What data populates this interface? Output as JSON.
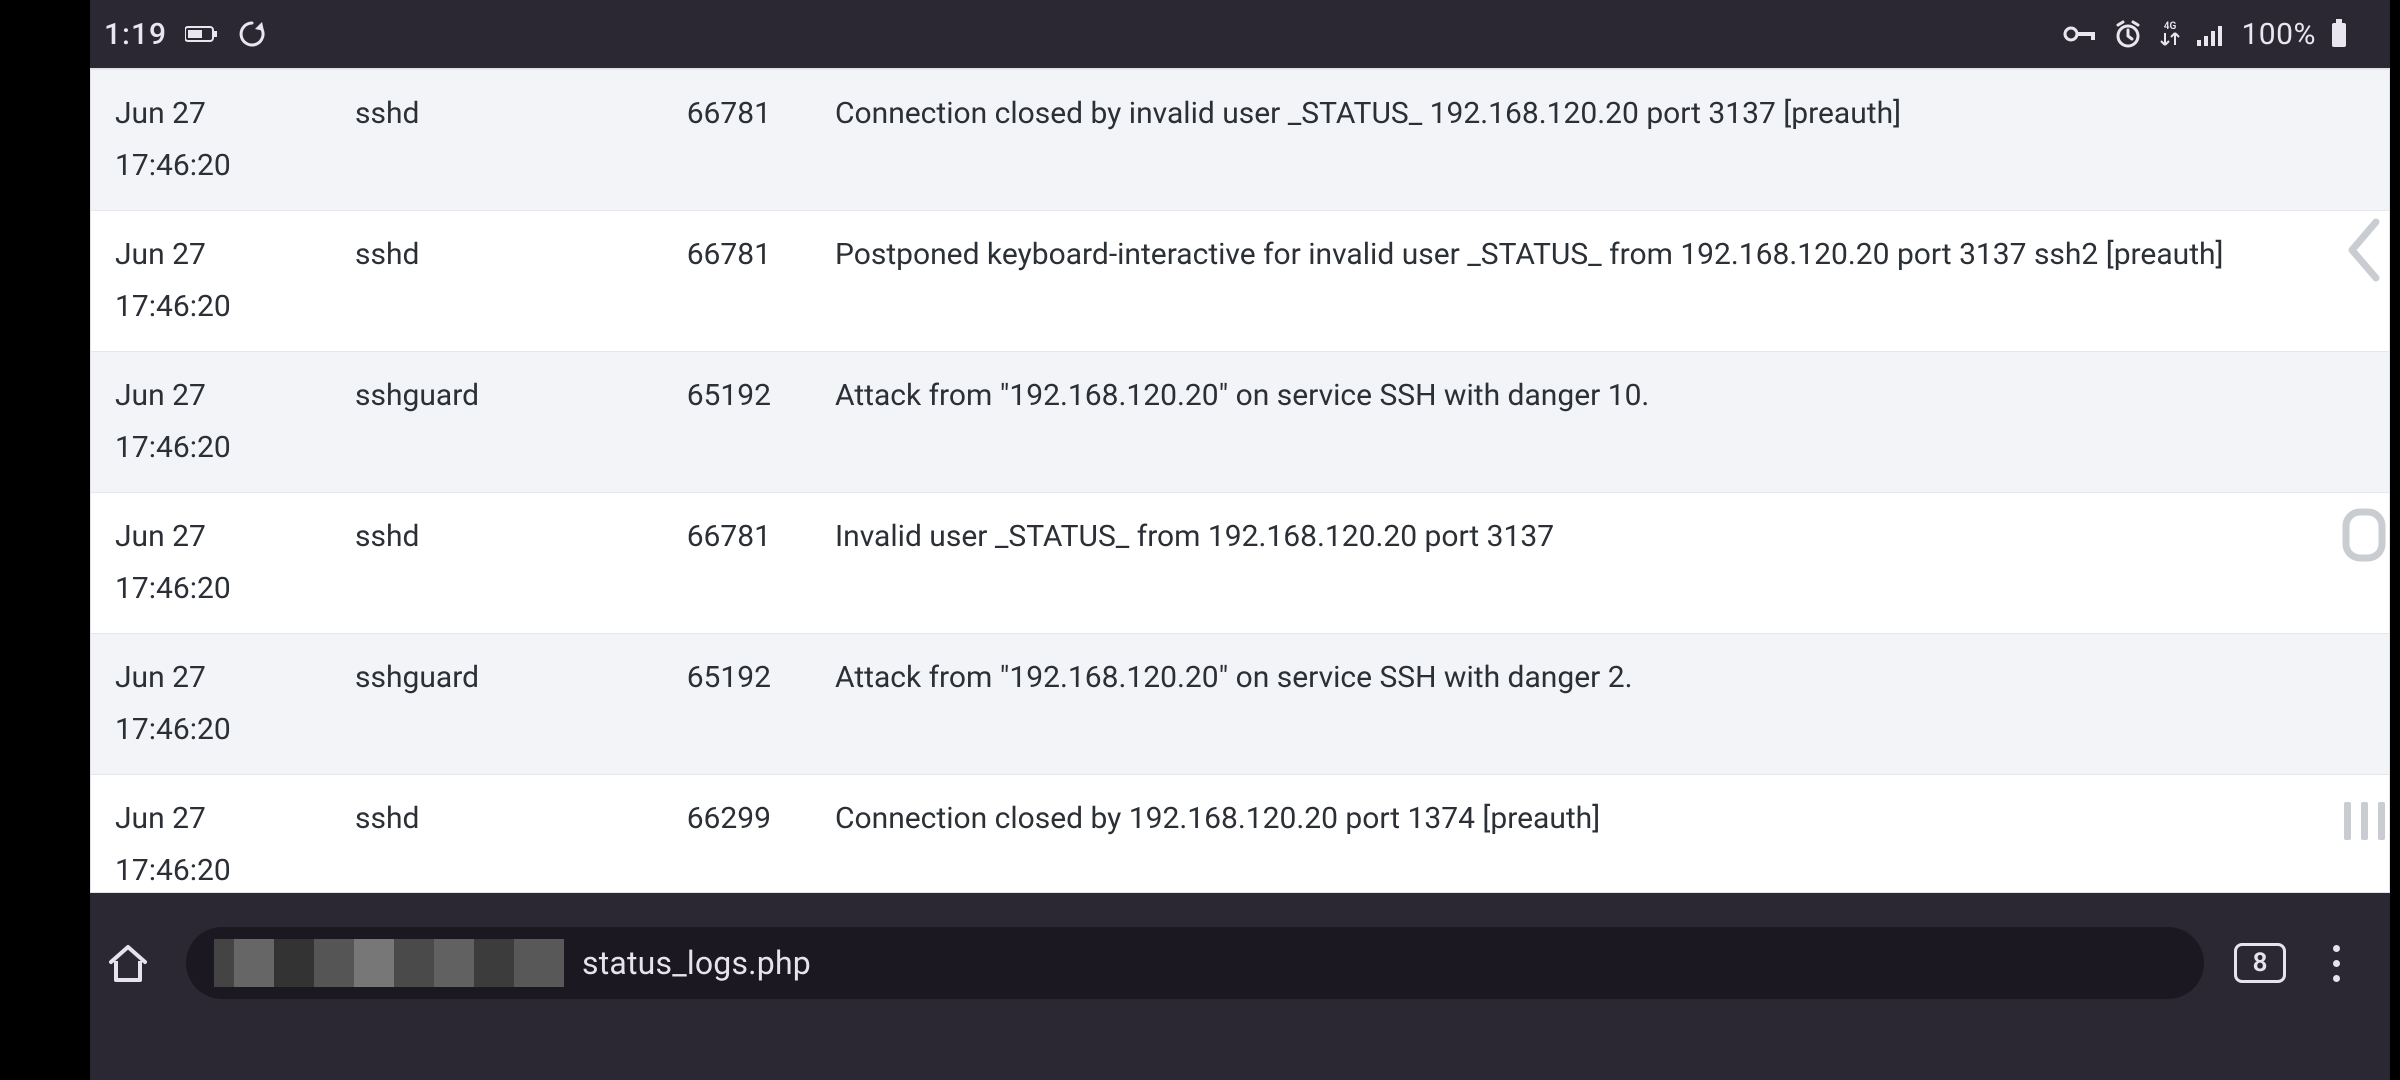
{
  "statusbar": {
    "time": "1:19",
    "battery_pct": "100%"
  },
  "logs": {
    "rows": [
      {
        "time": "Jun 27 17:46:20",
        "process": "sshd",
        "pid": "66781",
        "message": "Connection closed by invalid user _STATUS_ 192.168.120.20 port 3137 [preauth]"
      },
      {
        "time": "Jun 27 17:46:20",
        "process": "sshd",
        "pid": "66781",
        "message": "Postponed keyboard-interactive for invalid user _STATUS_ from 192.168.120.20 port 3137 ssh2 [preauth]"
      },
      {
        "time": "Jun 27 17:46:20",
        "process": "sshguard",
        "pid": "65192",
        "message": "Attack from \"192.168.120.20\" on service SSH with danger 10."
      },
      {
        "time": "Jun 27 17:46:20",
        "process": "sshd",
        "pid": "66781",
        "message": "Invalid user _STATUS_ from 192.168.120.20 port 3137"
      },
      {
        "time": "Jun 27 17:46:20",
        "process": "sshguard",
        "pid": "65192",
        "message": "Attack from \"192.168.120.20\" on service SSH with danger 2."
      },
      {
        "time": "Jun 27 17:46:20",
        "process": "sshd",
        "pid": "66299",
        "message": "Connection closed by 192.168.120.20 port 1374 [preauth]"
      }
    ]
  },
  "browser": {
    "url_visible": "status_logs.php",
    "tab_count": "8"
  }
}
